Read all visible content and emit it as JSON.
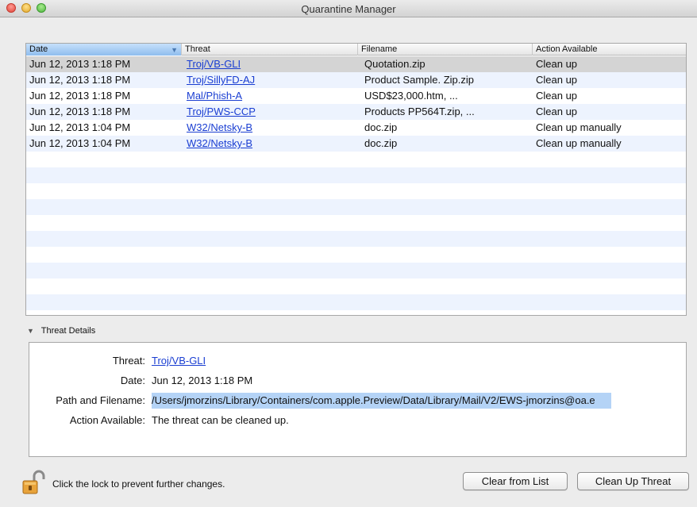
{
  "window": {
    "title": "Quarantine Manager"
  },
  "table": {
    "headers": {
      "date": "Date",
      "threat": "Threat",
      "filename": "Filename",
      "action": "Action Available"
    },
    "rows": [
      {
        "date": "Jun 12, 2013 1:18 PM",
        "threat": "Troj/VB-GLI",
        "filename": "Quotation.zip",
        "action": "Clean up"
      },
      {
        "date": "Jun 12, 2013 1:18 PM",
        "threat": "Troj/SillyFD-AJ",
        "filename": "Product Sample. Zip.zip",
        "action": "Clean up"
      },
      {
        "date": "Jun 12, 2013 1:18 PM",
        "threat": "Mal/Phish-A",
        "filename": "USD$23,000.htm, ...",
        "action": "Clean up"
      },
      {
        "date": "Jun 12, 2013 1:18 PM",
        "threat": "Troj/PWS-CCP",
        "filename": "Products PP564T.zip, ...",
        "action": "Clean up"
      },
      {
        "date": "Jun 12, 2013 1:04 PM",
        "threat": "W32/Netsky-B",
        "filename": "doc.zip",
        "action": "Clean up manually"
      },
      {
        "date": "Jun 12, 2013 1:04 PM",
        "threat": "W32/Netsky-B",
        "filename": "doc.zip",
        "action": "Clean up manually"
      }
    ]
  },
  "details": {
    "heading": "Threat Details",
    "threat_label": "Threat:",
    "threat_value": "Troj/VB-GLI",
    "date_label": "Date:",
    "date_value": "Jun 12, 2013 1:18 PM",
    "path_label": "Path and Filename:",
    "path_value": "/Users/jmorzins/Library/Containers/com.apple.Preview/Data/Library/Mail/V2/EWS-jmorzins@oa.e",
    "action_label": "Action Available:",
    "action_value": "The threat can be cleaned up."
  },
  "footer": {
    "lock_text": "Click the lock to prevent further changes.",
    "clear_button": "Clear from List",
    "clean_button": "Clean Up Threat"
  }
}
